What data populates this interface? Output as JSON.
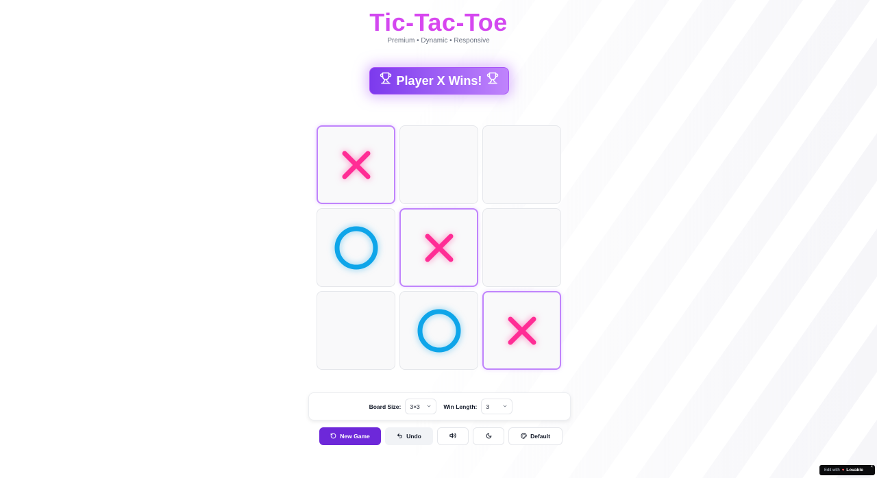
{
  "header": {
    "title": "Tic-Tac-Toe",
    "subtitle": "Premium • Dynamic • Responsive"
  },
  "status": {
    "text": "Player X Wins!",
    "icon": "trophy-icon"
  },
  "board": {
    "size": 3,
    "cells": [
      "X",
      "",
      "",
      "O",
      "X",
      "",
      "",
      "O",
      "X"
    ],
    "winning_cells": [
      0,
      4,
      8
    ]
  },
  "settings": {
    "board_size_label": "Board Size:",
    "board_size_value": "3×3",
    "win_length_label": "Win Length:",
    "win_length_value": "3"
  },
  "controls": {
    "new_game_label": "New Game",
    "undo_label": "Undo",
    "theme_label": "Default"
  },
  "footer": {
    "edit_with": "Edit with",
    "brand": "Lovable",
    "close": "×"
  },
  "colors": {
    "x": "#ff2d95",
    "o": "#0ea5e9",
    "accent": "#6d28d9",
    "win_border": "#c084fc"
  }
}
